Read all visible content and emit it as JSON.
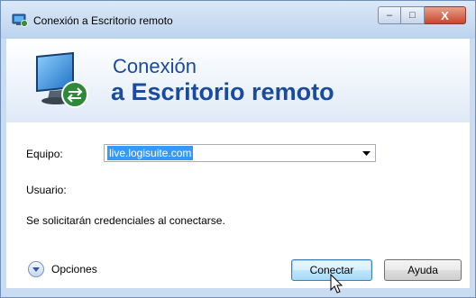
{
  "window": {
    "title": "Conexión a Escritorio remoto",
    "controls": {
      "minimize": "–",
      "maximize": "□",
      "close": "X"
    }
  },
  "banner": {
    "line1": "Conexión",
    "line2": "a Escritorio remoto"
  },
  "form": {
    "computer_label": "Equipo:",
    "computer_value": "live.logisuite.com",
    "user_label": "Usuario:",
    "credentials_note": "Se solicitarán credenciales al conectarse."
  },
  "footer": {
    "options_label": "Opciones",
    "connect_label": "Conectar",
    "help_label": "Ayuda"
  },
  "colors": {
    "accent": "#1a4b9c",
    "selection": "#3399ff",
    "close_button": "#c9462c"
  }
}
